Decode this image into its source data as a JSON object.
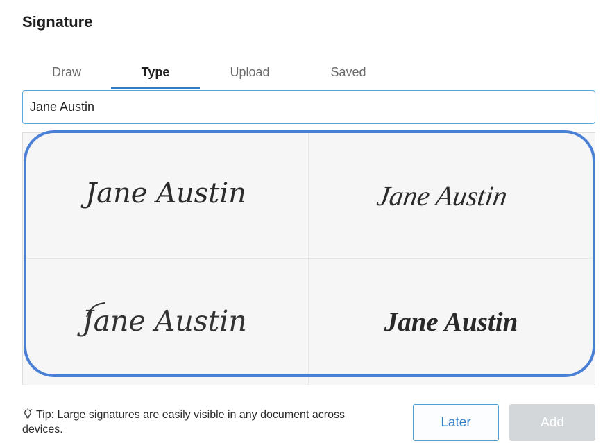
{
  "dialog": {
    "title": "Signature"
  },
  "tabs": [
    {
      "label": "Draw"
    },
    {
      "label": "Type",
      "active": true
    },
    {
      "label": "Upload"
    },
    {
      "label": "Saved"
    }
  ],
  "name_input": {
    "value": "Jane Austin"
  },
  "signature_options": [
    {
      "text": "Jane Austin",
      "style": "print-script"
    },
    {
      "text": "Jane Austin",
      "style": "slanted-script"
    },
    {
      "text": "Jane Austin",
      "style": "flourish-script"
    },
    {
      "text": "Jane Austin",
      "style": "bold-brush-script"
    }
  ],
  "tip": {
    "icon": "lightbulb-icon",
    "text": "Tip: Large signatures are easily visible in any document across devices."
  },
  "actions": {
    "later_label": "Later",
    "add_label": "Add",
    "add_enabled": false
  },
  "colors": {
    "accent": "#2f7dc9",
    "highlight": "#4a7fd6",
    "disabled": "#d4d7da"
  }
}
